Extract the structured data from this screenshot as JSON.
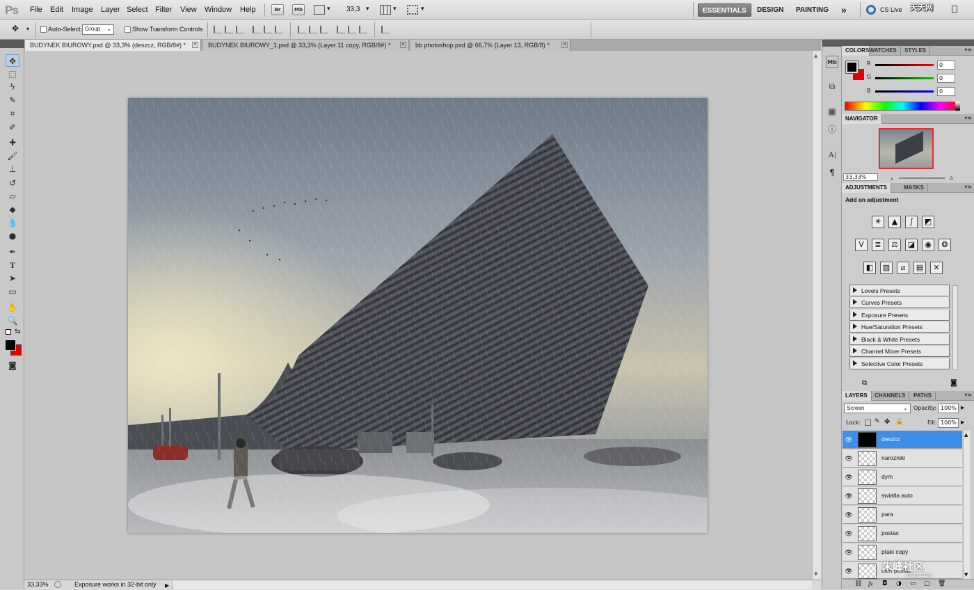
{
  "app": {
    "logo": "Ps"
  },
  "menu": [
    "File",
    "Edit",
    "Image",
    "Layer",
    "Select",
    "Filter",
    "View",
    "Window",
    "Help"
  ],
  "appbar": {
    "br_label": "Br",
    "mb_label": "Mb",
    "zoom": "33,3",
    "zoom_arrow": "▾"
  },
  "workspaces": [
    "ESSENTIALS",
    "DESIGN",
    "PAINTING"
  ],
  "workspace_more": "»",
  "cslive": "CS Live",
  "options": {
    "auto_select_label": "Auto-Select:",
    "auto_select_value": "Group",
    "show_transform_label": "Show Transform Controls"
  },
  "tabs": [
    {
      "label": "BUDYNEK BIUROWY.psd @ 33,3% (deszcz, RGB/8#) *",
      "active": true
    },
    {
      "label": "BUDYNEK BIUROWY_1.psd @ 33,3% (Layer 11 copy, RGB/8#) *",
      "active": false
    },
    {
      "label": "bb photoshop.psd @ 66,7% (Layer 13, RGB/8) *",
      "active": false
    }
  ],
  "tab_close": "✕",
  "status": {
    "zoom": "33,33%",
    "message": "Exposure works in 32-bit only"
  },
  "color_panel": {
    "tabs": [
      "COLOR",
      "SWATCHES",
      "STYLES"
    ],
    "channels": [
      {
        "label": "R",
        "value": "0"
      },
      {
        "label": "G",
        "value": "0"
      },
      {
        "label": "B",
        "value": "0"
      }
    ],
    "fg": "#000000",
    "bg": "#e00000"
  },
  "navigator": {
    "tab": "NAVIGATOR",
    "zoom": "33.33%"
  },
  "adjustments": {
    "tabs": [
      "ADJUSTMENTS",
      "MASKS"
    ],
    "heading": "Add an adjustment",
    "presets": [
      "Levels Presets",
      "Curves Presets",
      "Exposure Presets",
      "Hue/Saturation Presets",
      "Black & White Presets",
      "Channel Mixer Presets",
      "Selective Color Presets"
    ]
  },
  "layers_panel": {
    "tabs": [
      "LAYERS",
      "CHANNELS",
      "PATHS"
    ],
    "blend_mode": "Screen",
    "opacity_label": "Opacity:",
    "opacity": "100%",
    "lock_label": "Lock:",
    "fill_label": "Fill:",
    "fill": "100%",
    "layers": [
      "deszcz",
      "narozniki",
      "dym",
      "swiatla auto",
      "para",
      "postac",
      "ptaki copy",
      "cien postac"
    ],
    "selected": 0
  },
  "watermarks": {
    "top": "天天网",
    "bottom": "朱峰社区",
    "bottom_url": "ZF3D.COM"
  },
  "icons": {
    "eye": "👁",
    "fx": "fx"
  }
}
